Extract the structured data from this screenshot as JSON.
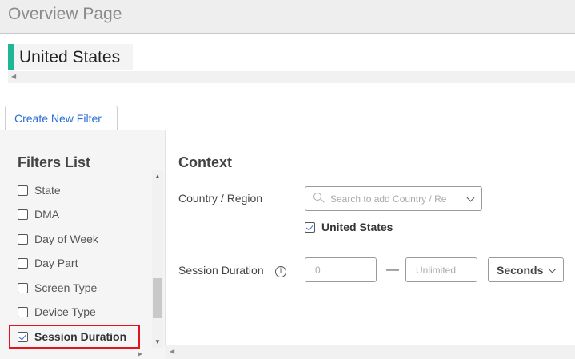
{
  "header": {
    "title": "Overview Page"
  },
  "selected_country": {
    "label": "United States",
    "accent_color": "#1fb597"
  },
  "tabs": [
    {
      "label": "Create New Filter",
      "active": true
    }
  ],
  "filters_list": {
    "heading": "Filters List",
    "items": [
      {
        "label": "State",
        "checked": false
      },
      {
        "label": "DMA",
        "checked": false
      },
      {
        "label": "Day of Week",
        "checked": false
      },
      {
        "label": "Day Part",
        "checked": false
      },
      {
        "label": "Screen Type",
        "checked": false
      },
      {
        "label": "Device Type",
        "checked": false
      },
      {
        "label": "Session Duration",
        "checked": true
      }
    ],
    "highlight_color": "#e0161e"
  },
  "context": {
    "heading": "Context",
    "country_region": {
      "label": "Country / Region",
      "search_placeholder": "Search to add Country / Re",
      "selected": {
        "label": "United States",
        "checked": true
      }
    },
    "session_duration": {
      "label": "Session Duration",
      "min_placeholder": "0",
      "separator": "—",
      "max_placeholder": "Unlimited",
      "unit": "Seconds"
    }
  },
  "icons": {
    "search": "search-icon",
    "info": "info-icon",
    "chevron": "chevron-down-icon"
  }
}
